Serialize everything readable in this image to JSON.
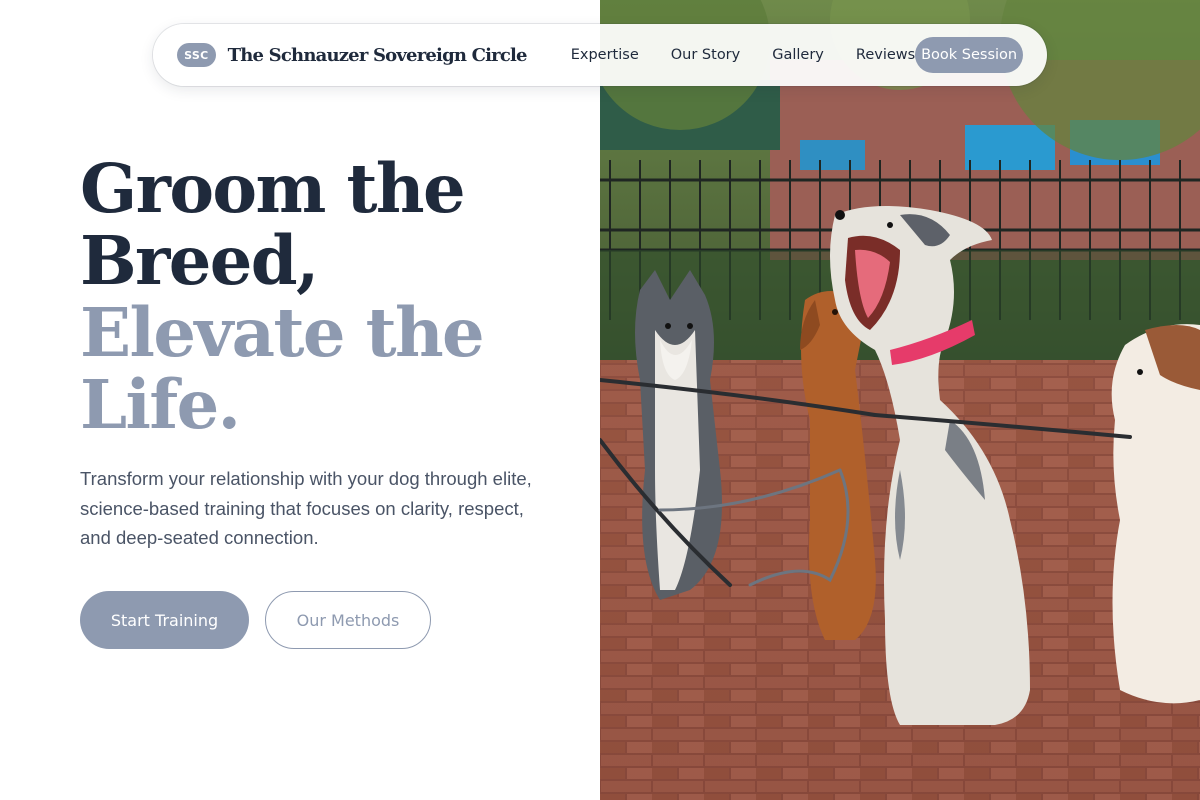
{
  "nav": {
    "logo_badge": "SSC",
    "brand": "The Schnauzer Sovereign Circle",
    "links": [
      "Expertise",
      "Our Story",
      "Gallery",
      "Reviews"
    ],
    "cta": "Book Session"
  },
  "hero": {
    "headline_dark": [
      "Groom the",
      "Breed,"
    ],
    "headline_light": [
      "Elevate the",
      "Life."
    ],
    "lede": "Transform your relationship with your dog through elite, science-based training that focuses on clarity, respect, and deep-seated connection.",
    "primary_cta": "Start Training",
    "secondary_cta": "Our Methods",
    "image_subject": "dogs-on-leashes-in-park-photo"
  },
  "colors": {
    "accent": "#8e9ab0",
    "text_dark": "#1f2a3c",
    "text_body": "#4a5466",
    "background": "#ffffff"
  }
}
